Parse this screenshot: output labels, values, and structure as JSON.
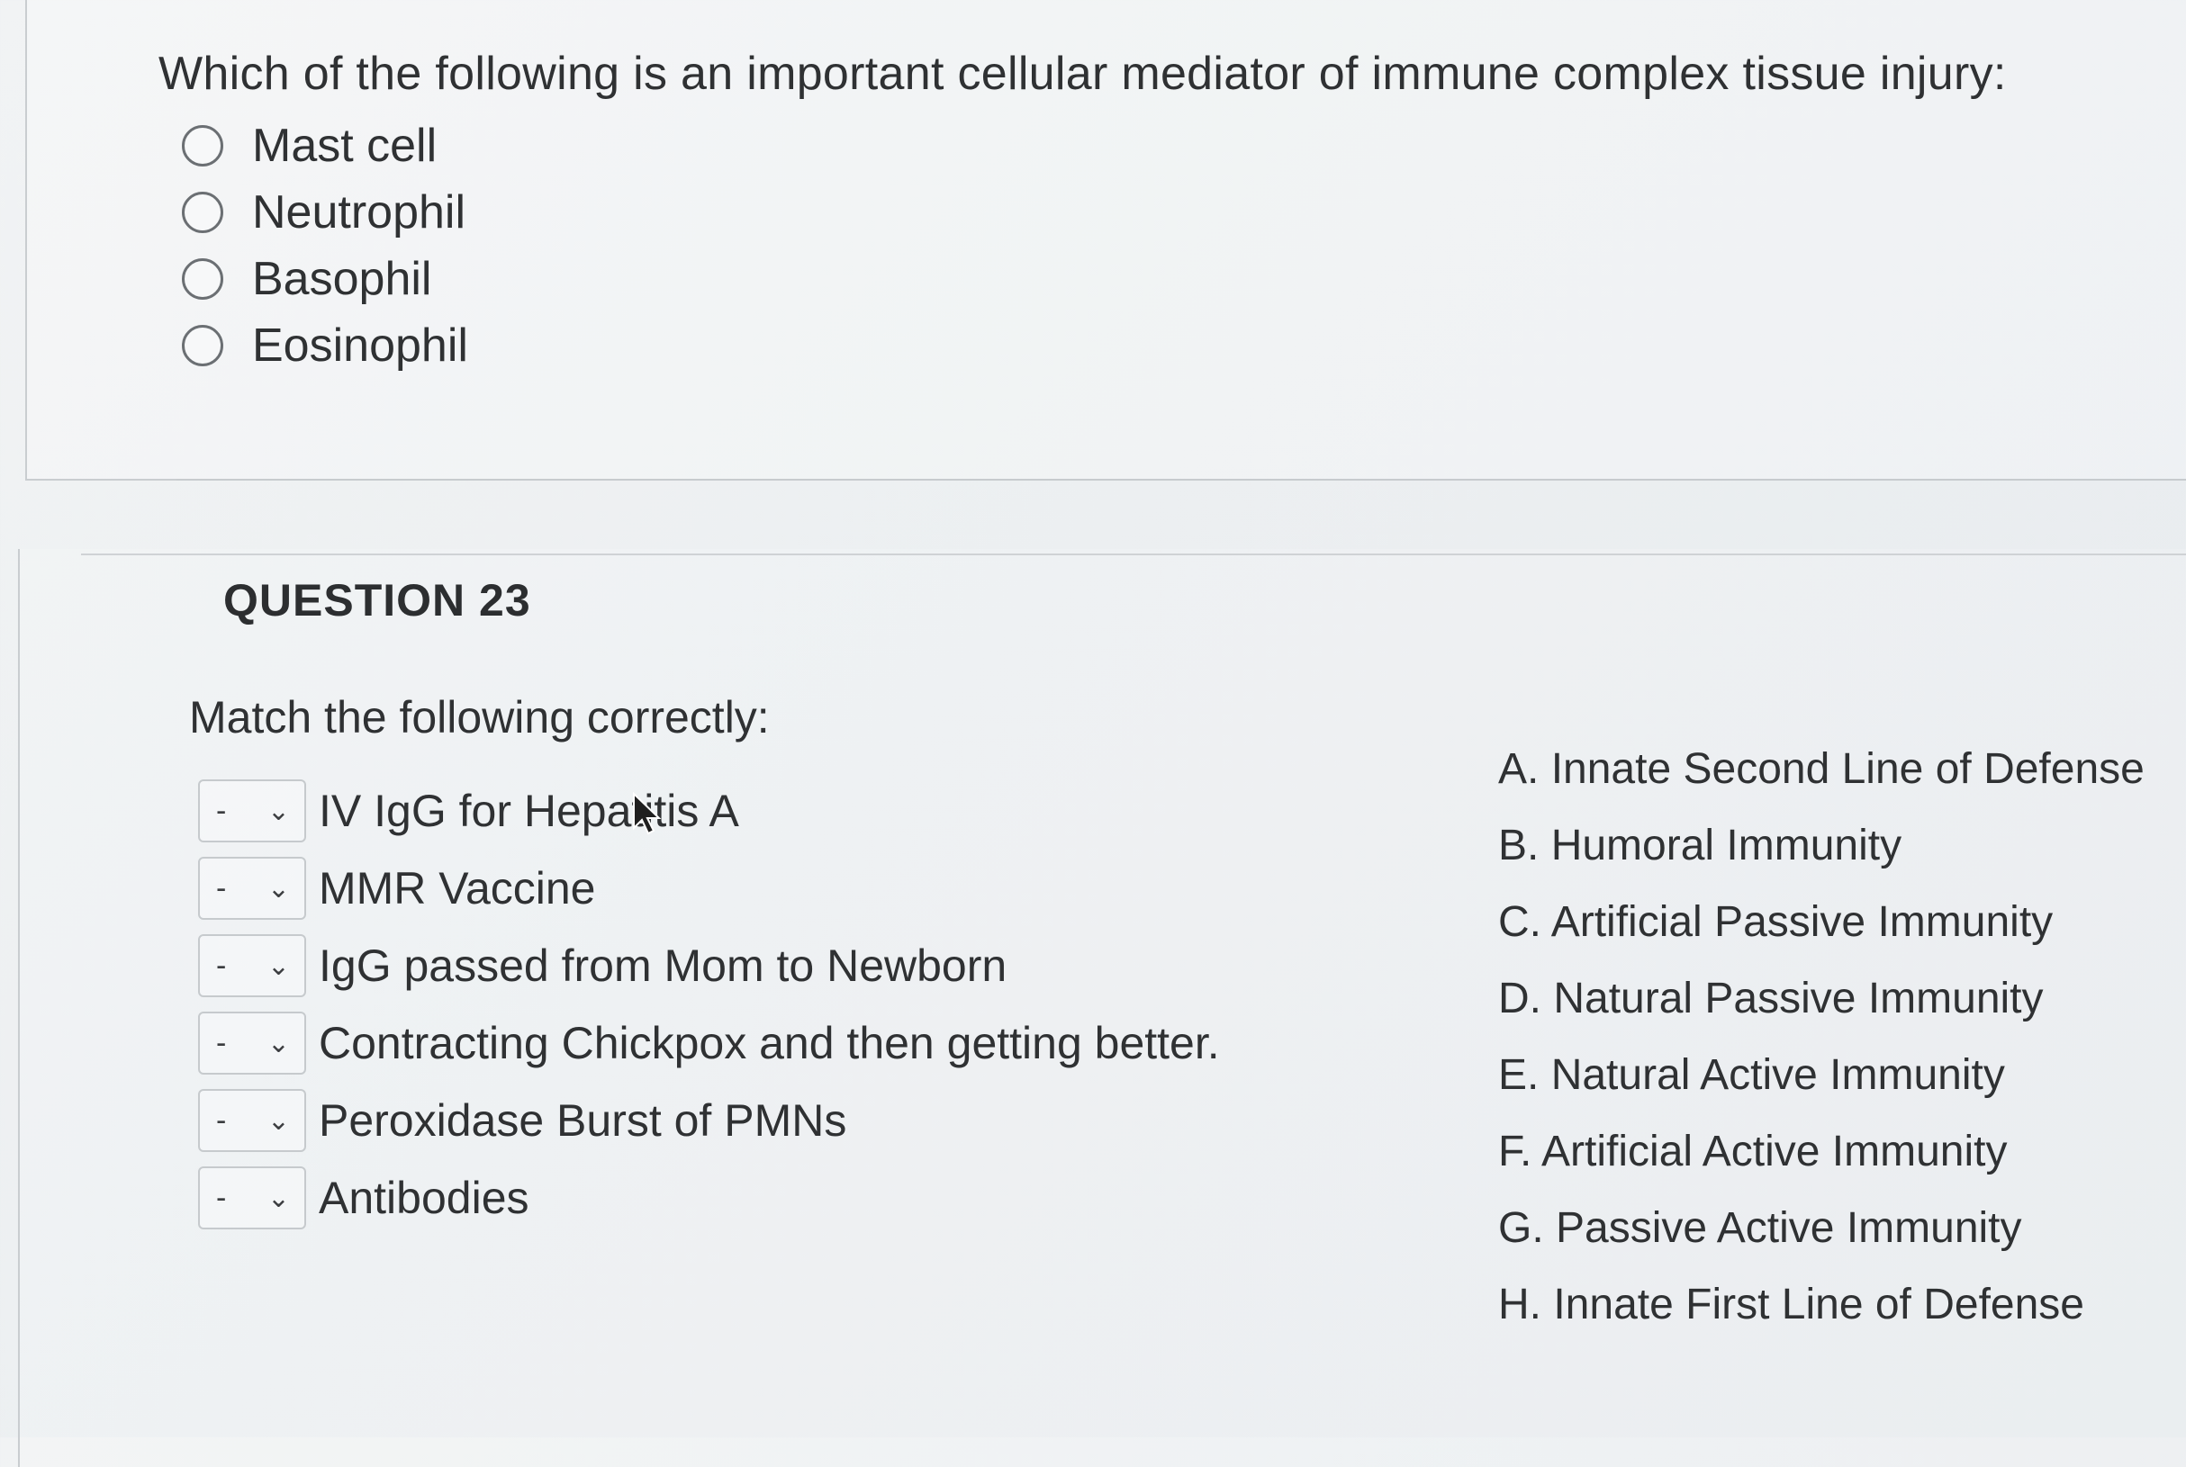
{
  "question_prev": {
    "text": "Which of the following is an important cellular mediator of immune complex tissue injury:",
    "options": [
      "Mast cell",
      "Neutrophil",
      "Basophil",
      "Eosinophil"
    ]
  },
  "question_23": {
    "label": "QUESTION 23",
    "prompt": "Match the following correctly:",
    "items": [
      {
        "selected": "-",
        "text": "IV IgG for Hepatitis A"
      },
      {
        "selected": "-",
        "text": "MMR Vaccine"
      },
      {
        "selected": "-",
        "text": "IgG passed from Mom to Newborn"
      },
      {
        "selected": "-",
        "text": "Contracting Chickpox and then getting better."
      },
      {
        "selected": "-",
        "text": "Peroxidase Burst of PMNs"
      },
      {
        "selected": "-",
        "text": "Antibodies"
      }
    ],
    "answers": [
      "A. Innate Second Line of Defense",
      "B. Humoral Immunity",
      "C. Artificial Passive Immunity",
      "D. Natural Passive Immunity",
      "E. Natural Active Immunity",
      "F. Artificial Active Immunity",
      "G. Passive Active Immunity",
      "H. Innate First Line of Defense"
    ]
  },
  "icons": {
    "dropdown": "chevron-down-icon",
    "radio": "radio-unchecked-icon",
    "pointer": "mouse-pointer-icon"
  }
}
